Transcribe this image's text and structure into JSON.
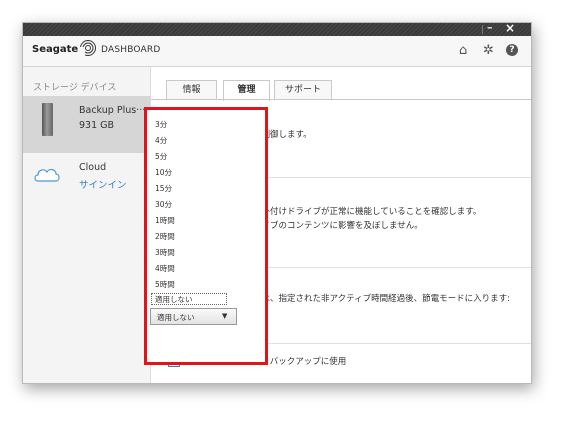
{
  "window": {
    "minimize": "–",
    "close": "×"
  },
  "header": {
    "brand": "Seagate",
    "app_name": "DASHBOARD",
    "icons": [
      "home-icon",
      "gear-icon",
      "help-icon"
    ],
    "icon_glyphs": {
      "home": "⌂",
      "gear": "✲",
      "help": "?"
    }
  },
  "sidebar": {
    "title": "ストレージ デバイス",
    "devices": [
      {
        "name": "Backup Plus···",
        "detail": "931 GB",
        "icon": "external-drive-icon",
        "selected": true
      },
      {
        "name": "Cloud",
        "detail": "サインイン",
        "icon": "cloud-icon",
        "selected": false
      }
    ]
  },
  "tabs": [
    {
      "label": "情報",
      "active": false
    },
    {
      "label": "管理",
      "active": true
    },
    {
      "label": "サポート",
      "active": false
    }
  ],
  "main": {
    "line1": "を制御します。",
    "line2": "、外付けドライブが正常に機能していることを確認します。",
    "line3": "ライブのコンテンツに影響を及ぼしません。",
    "line4": "カ",
    "line5": "ブは、指定された非アクティブ時間経過後、節電モードに入ります:",
    "default_backup_checkbox": {
      "checked": true,
      "label": "この機器をデフォルト バックアップに使用"
    }
  },
  "dropdown": {
    "options": [
      "3分",
      "4分",
      "5分",
      "10分",
      "15分",
      "30分",
      "1時間",
      "2時間",
      "3時間",
      "4時間",
      "5時間",
      "適用しない"
    ],
    "selected": "適用しない",
    "select_value": "適用しない",
    "highlight_color": "#e1141b"
  },
  "colors": {
    "link_blue": "#3a7fc4",
    "check_blue": "#1e9be0",
    "accent_green": "#7a9a00"
  }
}
